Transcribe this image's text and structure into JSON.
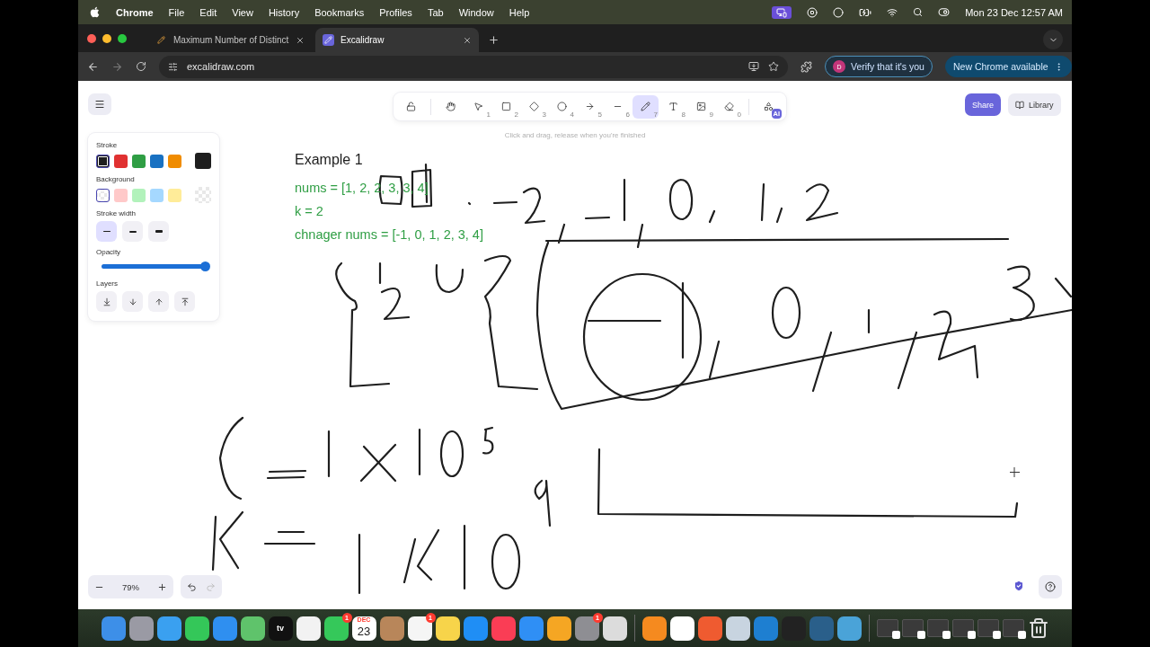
{
  "menu_bar": {
    "app": "Chrome",
    "items": [
      "File",
      "Edit",
      "View",
      "History",
      "Bookmarks",
      "Profiles",
      "Tab",
      "Window",
      "Help"
    ],
    "clock": "Mon 23 Dec  12:57 AM"
  },
  "browser": {
    "tabs": [
      {
        "title": "Maximum Number of Distinct",
        "selected": false
      },
      {
        "title": "Excalidraw",
        "selected": true
      }
    ],
    "address": "excalidraw.com",
    "profile_initial": "D",
    "verify_button": "Verify that it's you",
    "update_button": "New Chrome available"
  },
  "toolbar": {
    "tools": [
      {
        "selected": false
      },
      {
        "selected": false
      },
      {
        "shortcut": "1",
        "selected": false
      },
      {
        "shortcut": "2",
        "selected": false
      },
      {
        "shortcut": "3",
        "selected": false
      },
      {
        "shortcut": "4",
        "selected": false
      },
      {
        "shortcut": "5",
        "selected": false
      },
      {
        "shortcut": "6",
        "selected": false
      },
      {
        "shortcut": "7",
        "selected": true
      },
      {
        "shortcut": "8",
        "selected": false
      },
      {
        "shortcut": "9",
        "selected": false
      },
      {
        "shortcut": "0",
        "selected": false
      },
      {
        "badge": "AI",
        "selected": false
      }
    ],
    "hint": "Click and drag, release when you're finished",
    "share_button": "Share",
    "library_button": "Library"
  },
  "properties": {
    "stroke_label": "Stroke",
    "stroke_colors": [
      {
        "color": "#1e1e1e",
        "selected": true
      },
      {
        "color": "#e03131",
        "selected": false
      },
      {
        "color": "#2f9e44",
        "selected": false
      },
      {
        "color": "#1971c2",
        "selected": false
      },
      {
        "color": "#f08c00",
        "selected": false
      }
    ],
    "stroke_current": {
      "color": "#1e1e1e"
    },
    "background_label": "Background",
    "background_colors": [
      {
        "kind": "transparent",
        "selected": true
      },
      {
        "kind": "solid",
        "color": "#ffc9c9",
        "selected": false
      },
      {
        "kind": "solid",
        "color": "#b2f2bb",
        "selected": false
      },
      {
        "kind": "solid",
        "color": "#a5d8ff",
        "selected": false
      },
      {
        "kind": "solid",
        "color": "#ffec99",
        "selected": false
      }
    ],
    "background_current": {
      "kind": "transparent"
    },
    "stroke_width_label": "Stroke width",
    "stroke_widths": [
      {
        "selected": true
      },
      {
        "selected": false
      },
      {
        "selected": false
      }
    ],
    "opacity_label": "Opacity",
    "opacity": {
      "level": 1
    },
    "layers_label": "Layers"
  },
  "canvas": {
    "title": "Example 1",
    "lines": [
      "nums = [1, 2, 2, 3, 3, 4]",
      "k = 2",
      "chnager nums = [-1, 0, 1, 2, 3, 4]"
    ]
  },
  "footer": {
    "zoom": "79%"
  },
  "dock": {
    "apps": [
      {
        "kind": "app",
        "color": "#3d8fe8"
      },
      {
        "kind": "app",
        "color": "#9a9aa4"
      },
      {
        "kind": "app",
        "color": "#3aa0f0"
      },
      {
        "kind": "app",
        "color": "#34c759"
      },
      {
        "kind": "app",
        "color": "#2f8ff0"
      },
      {
        "kind": "app",
        "color": "#5fc36b"
      },
      {
        "kind": "tv",
        "label": "tv"
      },
      {
        "kind": "app",
        "color": "#f2f2f2"
      },
      {
        "kind": "app",
        "color": "#35c85a",
        "badge": "1"
      },
      {
        "kind": "calendar",
        "month": "DEC",
        "day": "23"
      },
      {
        "kind": "app",
        "color": "#b8865a"
      },
      {
        "kind": "app",
        "color": "#f5f5f5",
        "badge": "1"
      },
      {
        "kind": "app",
        "color": "#f7d44a"
      },
      {
        "kind": "app",
        "color": "#1f8ef5"
      },
      {
        "kind": "app",
        "color": "#fa3d55"
      },
      {
        "kind": "app",
        "color": "#2f8ff5"
      },
      {
        "kind": "app",
        "color": "#f5a623"
      },
      {
        "kind": "app",
        "color": "#8e8e93",
        "badge": "1"
      },
      {
        "kind": "app",
        "color": "#dcdcdc"
      },
      {
        "kind": "separator"
      },
      {
        "kind": "app",
        "color": "#f58a1f"
      },
      {
        "kind": "app",
        "color": "#ffffff"
      },
      {
        "kind": "app",
        "color": "#ef5b30"
      },
      {
        "kind": "app",
        "color": "#c8d4e0"
      },
      {
        "kind": "app",
        "color": "#1e7fd1"
      },
      {
        "kind": "app",
        "color": "#222222"
      },
      {
        "kind": "app",
        "color": "#2a5f8a"
      },
      {
        "kind": "app",
        "color": "#4aa3d8"
      },
      {
        "kind": "separator"
      },
      {
        "kind": "window"
      },
      {
        "kind": "window"
      },
      {
        "kind": "window"
      },
      {
        "kind": "window"
      },
      {
        "kind": "window"
      },
      {
        "kind": "window"
      },
      {
        "kind": "trash"
      }
    ]
  }
}
